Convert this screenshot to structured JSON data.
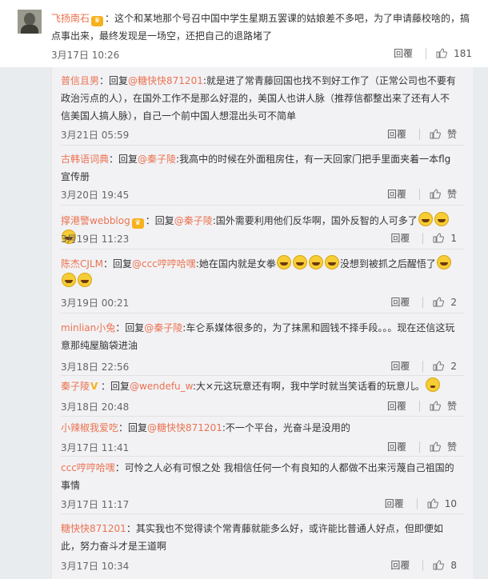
{
  "top": {
    "user": "飞扬南石",
    "text": "：这个和某地那个号召中国中学生星期五罢课的姑娘差不多吧，为了申请藤校啥的，搞点事出来，最终发现是一场空，还把自己的退路堵了",
    "date": "3月17日 10:26",
    "reply_label": "回覆",
    "likes": "181"
  },
  "replies": [
    {
      "user": "普信且男",
      "mid": "：回复",
      "at": "@糖快快871201",
      "text": ":就是进了常青藤回国也找不到好工作了（正常公司也不要有政治污点的人），在国外工作不是那么好混的，美国人也讲人脉（推荐信都整出来了还有人不信美国人搞人脉），自己一个前中国人想混出头可不简单",
      "date": "3月21日 05:59",
      "reply": "回覆",
      "likes": "赞"
    },
    {
      "user": "古韩语词典",
      "mid": "：回复",
      "at": "@秦子陵",
      "text": ":我高中的时候在外面租房住，有一天回家门把手里面夹着一本flg宣传册",
      "date": "3月20日 19:45",
      "reply": "回覆",
      "likes": "赞"
    },
    {
      "user": "撑港警webblog",
      "mid": "：回复",
      "at": "@秦子陵",
      "text": ":国外需要利用他们反华啊，国外反智的人可多了",
      "date": "3月19日 11:23",
      "reply": "回覆",
      "likes": "1"
    },
    {
      "user": "陈杰CJLM",
      "mid": "：回复",
      "at": "@ccc哼哼哈嘿",
      "text": ":她在国内就是女拳",
      "text2": "没想到被抓之后醒悟了",
      "date": "3月19日 00:21",
      "reply": "回覆",
      "likes": "2"
    },
    {
      "user": "minlian小兔",
      "mid": "：回复",
      "at": "@秦子陵",
      "text": ":车仑系媒体很多的，为了抹黑和圆钱不择手段。。。现在还信这玩意那纯屋脑袋进油",
      "date": "3月18日 22:56",
      "reply": "回覆",
      "likes": "2"
    },
    {
      "user": "秦子陵",
      "mid": "：回复",
      "at": "@wendefu_w",
      "text": ":大×元这玩意还有啊，我中学时就当笑话看的玩意儿。",
      "date": "3月18日 20:48",
      "reply": "回覆",
      "likes": "赞"
    },
    {
      "user": "小辣椒我爱吃",
      "mid": "：回复",
      "at": "@糖快快871201",
      "text": ":不一个平台，光奋斗是没用的",
      "date": "3月17日 11:41",
      "reply": "回覆",
      "likes": "赞"
    },
    {
      "user": "ccc哼哼哈嘿",
      "mid": "",
      "at": "",
      "text": "：可怜之人必有可恨之处 我相信任何一个有良知的人都做不出来污蔑自己祖国的事情",
      "date": "3月17日 11:17",
      "reply": "回覆",
      "likes": "10"
    },
    {
      "user": "糖快快871201",
      "mid": "",
      "at": "",
      "text": "：其实我也不觉得读个常青藤就能多么好，或许能比普通人好点，但即便如此，努力奋斗才是王道啊",
      "date": "3月17日 10:34",
      "reply": "回覆",
      "likes": "8"
    }
  ],
  "icons": {
    "like": "thumbs-up-icon",
    "badge": "member-badge-icon",
    "emoji": "laughing-emoji-icon"
  },
  "colors": {
    "username": "#eb7350",
    "mention": "#eb7350",
    "background": "#e9ecef"
  }
}
